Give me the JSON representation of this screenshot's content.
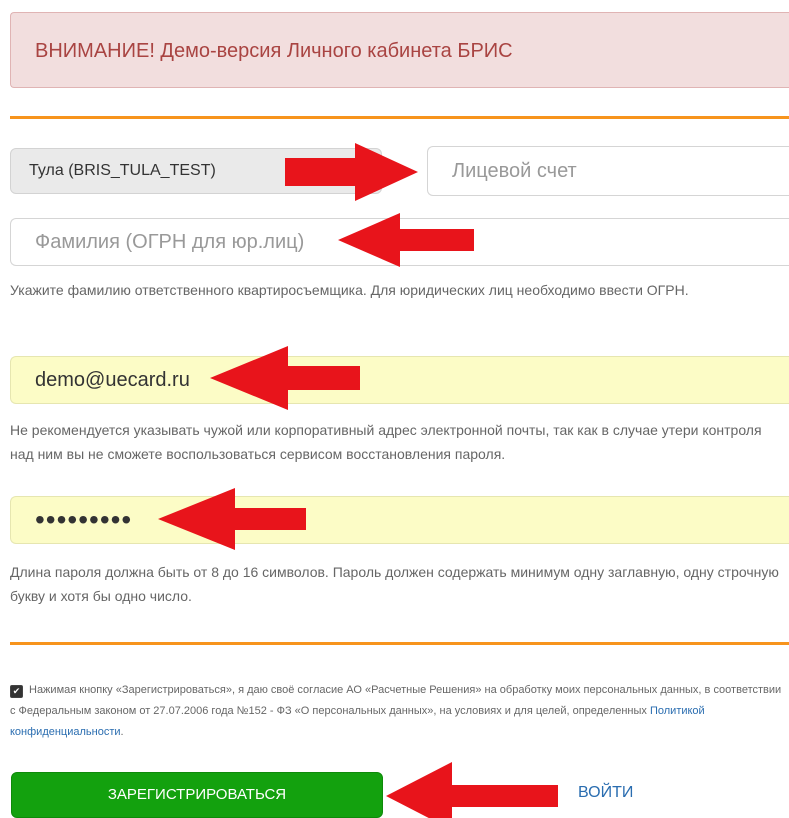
{
  "alert": {
    "text": "ВНИМАНИЕ! Демо-версия Личного кабинета БРИС"
  },
  "form": {
    "region_value": "Тула (BRIS_TULA_TEST)",
    "account_placeholder": "Лицевой счет",
    "surname_placeholder": "Фамилия (ОГРН для юр.лиц)",
    "surname_help": "Укажите фамилию ответственного квартиросъемщика. Для юридических лиц необходимо ввести ОГРН.",
    "email_value": "demo@uecard.ru",
    "email_help": "Не рекомендуется указывать чужой или корпоративный адрес электронной почты, так как в случае утери контроля над ним вы не сможете воспользоваться сервисом восстановления пароля.",
    "password_value": "•••••••••",
    "password_help": "Длина пароля должна быть от 8 до 16 символов. Пароль должен содержать минимум одну заглавную, одну строчную букву и хотя бы одно число."
  },
  "consent": {
    "checked": true,
    "text": "Нажимая кнопку «Зарегистрироваться», я даю своё согласие АО «Расчетные Решения» на обработку моих персональных данных, в соответствии с Федеральным законом от 27.07.2006 года №152 - ФЗ «О персональных данных», на условиях и для целей, определенных ",
    "link_text": "Политикой конфиденциальности",
    "suffix": "."
  },
  "buttons": {
    "register_label": "ЗАРЕГИСТРИРОВАТЬСЯ",
    "login_label": "ВОЙТИ"
  },
  "colors": {
    "alert_bg": "#f2dede",
    "alert_text": "#a94442",
    "divider": "#f7941d",
    "autofill_yellow": "#fcfcc6",
    "register_green": "#13a10e",
    "link_blue": "#2a6db0",
    "annotation_arrow": "#e8141b"
  }
}
